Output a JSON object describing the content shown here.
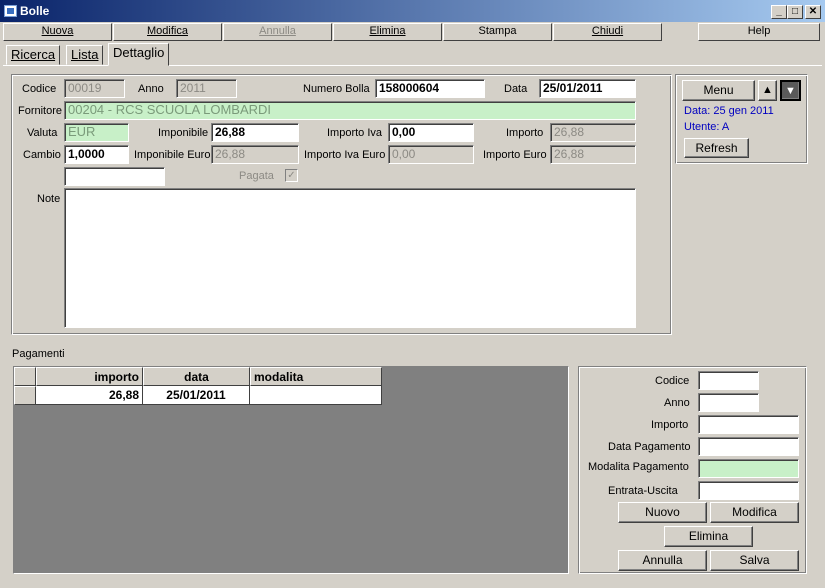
{
  "window": {
    "title": "Bolle",
    "minimize": "_",
    "maximize": "□",
    "close": "✕"
  },
  "menu": {
    "nuova": "Nuova",
    "modifica": "Modifica",
    "annulla": "Annulla",
    "elimina": "Elimina",
    "stampa": "Stampa",
    "chiudi": "Chiudi",
    "help": "Help"
  },
  "tabs": {
    "ricerca": "Ricerca",
    "lista": "Lista",
    "dettaglio": "Dettaglio"
  },
  "form": {
    "codice_label": "Codice",
    "codice": "00019",
    "anno_label": "Anno",
    "anno": "2011",
    "numero_bolla_label": "Numero Bolla",
    "numero_bolla": "158000604",
    "data_label": "Data",
    "data": "25/01/2011",
    "fornitore_label": "Fornitore",
    "fornitore": "00204 - RCS SCUOLA LOMBARDI",
    "valuta_label": "Valuta",
    "valuta": "EUR",
    "imponibile_label": "Imponibile",
    "imponibile": "26,88",
    "importo_iva_label": "Importo Iva",
    "importo_iva": "0,00",
    "importo_label": "Importo",
    "importo": "26,88",
    "cambio_label": "Cambio",
    "cambio": "1,0000",
    "imponibile_euro_label": "Imponibile Euro",
    "imponibile_euro": "26,88",
    "importo_iva_euro_label": "Importo Iva Euro",
    "importo_iva_euro": "0,00",
    "importo_euro_label": "Importo Euro",
    "importo_euro": "26,88",
    "pagata_label": "Pagata",
    "pagata_check": "✓",
    "note_label": "Note"
  },
  "side": {
    "menu": "Menu",
    "up": "▲",
    "down": "▼",
    "data_line": "Data: 25 gen 2011",
    "utente_line": "Utente: A",
    "refresh": "Refresh"
  },
  "pagamenti": {
    "section_label": "Pagamenti",
    "columns": [
      "importo",
      "data",
      "modalita"
    ],
    "rows": [
      {
        "importo": "26,88",
        "data": "25/01/2011",
        "modalita": ""
      }
    ]
  },
  "payment_form": {
    "codice_label": "Codice",
    "anno_label": "Anno",
    "importo_label": "Importo",
    "data_pagamento_label": "Data Pagamento",
    "modalita_pagamento_label": "Modalita Pagamento",
    "entrata_uscita_label": "Entrata-Uscita",
    "nuovo": "Nuovo",
    "modifica": "Modifica",
    "elimina": "Elimina",
    "annulla": "Annulla",
    "salva": "Salva"
  }
}
